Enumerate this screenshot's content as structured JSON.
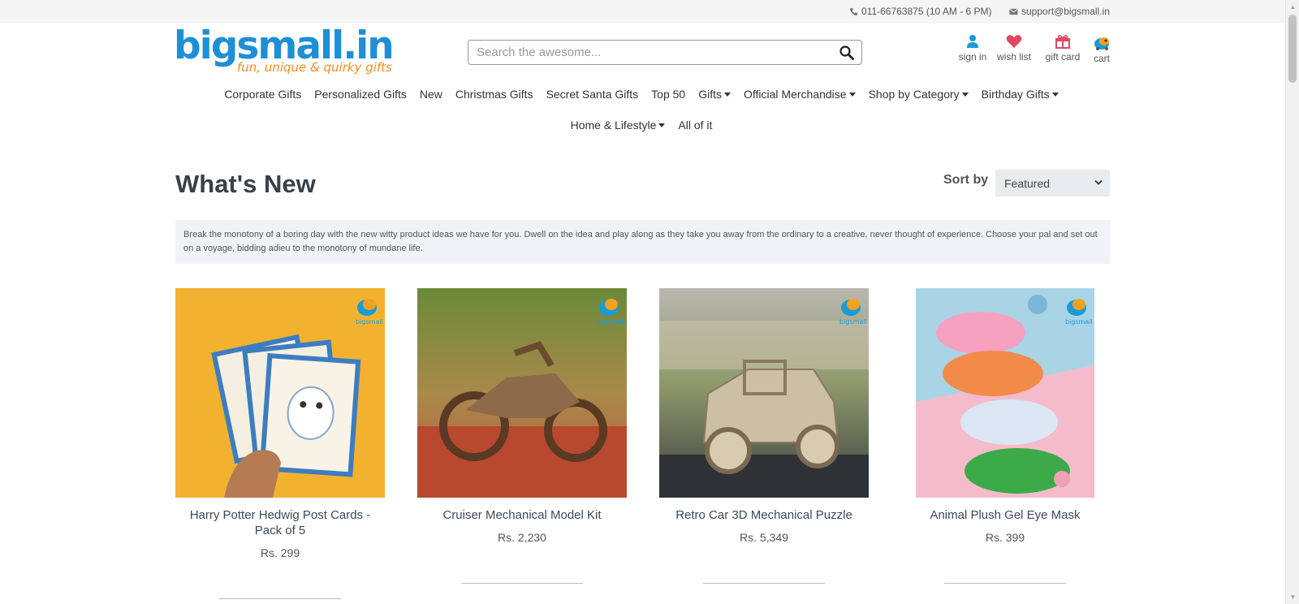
{
  "topbar": {
    "phone": "011-66763875 (10 AM - 6 PM)",
    "email": "support@bigsmall.in"
  },
  "logo": {
    "wordmark": "bigsmall.in",
    "tagline": "fun, unique & quirky gifts"
  },
  "search": {
    "placeholder": "Search the awesome..."
  },
  "account": {
    "sign_in": "sign in",
    "wish_list": "wish list",
    "gift_card": "gift card",
    "cart": "cart"
  },
  "nav": {
    "row1": [
      {
        "label": "Corporate Gifts",
        "dropdown": false
      },
      {
        "label": "Personalized Gifts",
        "dropdown": false
      },
      {
        "label": "New",
        "dropdown": false
      },
      {
        "label": "Christmas Gifts",
        "dropdown": false
      },
      {
        "label": "Secret Santa Gifts",
        "dropdown": false
      },
      {
        "label": "Top 50",
        "dropdown": false
      },
      {
        "label": "Gifts",
        "dropdown": true
      },
      {
        "label": "Official Merchandise",
        "dropdown": true
      },
      {
        "label": "Shop by Category",
        "dropdown": true
      },
      {
        "label": "Birthday Gifts",
        "dropdown": true
      }
    ],
    "row2": [
      {
        "label": "Home & Lifestyle",
        "dropdown": true
      },
      {
        "label": "All of it",
        "dropdown": false
      }
    ]
  },
  "main": {
    "title": "What's New",
    "sort_label": "Sort by",
    "sort_value": "Featured",
    "intro": "Break the monotony of a boring day with the new witty product ideas we have for you. Dwell on the idea and play along as they take you away from the ordinary to a creative, never thought of experience. Choose your pal and set out on a voyage, bidding adieu to the monotony of mundane life."
  },
  "products": [
    {
      "name": "Harry Potter Hedwig Post Cards - Pack of 5",
      "price": "Rs. 299"
    },
    {
      "name": "Cruiser Mechanical Model Kit",
      "price": "Rs. 2,230"
    },
    {
      "name": "Retro Car 3D Mechanical Puzzle",
      "price": "Rs. 5,349"
    },
    {
      "name": "Animal Plush Gel Eye Mask",
      "price": "Rs. 399"
    }
  ],
  "colors": {
    "brand_blue": "#1e8fd6",
    "brand_orange": "#f28c1f",
    "wish_red": "#e04861",
    "signin_blue": "#1a9bd7"
  }
}
